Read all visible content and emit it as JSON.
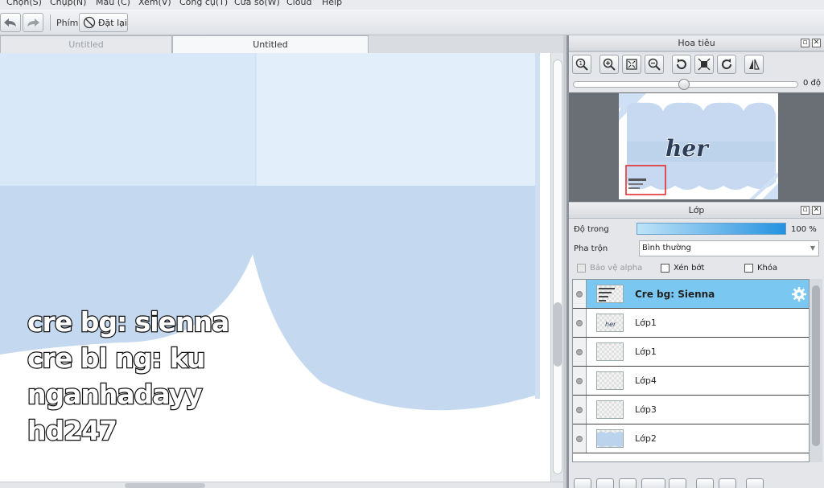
{
  "menu": [
    "Chọn(S)",
    "Chụp(N)",
    "Màu (C)",
    "Xem(V)",
    "Công cụ(T)",
    "Cửa sổ(W)",
    "Cloud",
    "Help"
  ],
  "toolbar": {
    "key_label": "Phím",
    "reset_label": "Đặt lại"
  },
  "tabs": [
    {
      "label": "Untitled",
      "active": false
    },
    {
      "label": "Untitled",
      "active": true
    }
  ],
  "canvas": {
    "credit_lines": [
      "cre bg: sienna",
      "cre bl ng: ku",
      "nganhadayy",
      "hd247"
    ],
    "colors": {
      "light_blue": "#d6e6f7",
      "mid_blue": "#bed5ee",
      "deep_blue": "#b7cfea"
    }
  },
  "navigator": {
    "title": "Hoa tiêu",
    "zoom_angle": "0 độ",
    "preview_text": "her"
  },
  "layers_panel": {
    "title": "Lớp",
    "opacity_label": "Độ trong",
    "opacity_value": "100 %",
    "blend_label": "Pha trộn",
    "blend_value": "Bình thường",
    "protect_alpha": "Bảo vệ alpha",
    "clipping": "Xén bớt",
    "lock": "Khóa",
    "layers": [
      {
        "name": "Cre bg: Sienna",
        "selected": true
      },
      {
        "name": "Lớp1",
        "selected": false
      },
      {
        "name": "Lớp1",
        "selected": false
      },
      {
        "name": "Lớp4",
        "selected": false
      },
      {
        "name": "Lớp3",
        "selected": false
      },
      {
        "name": "Lớp2",
        "selected": false
      }
    ]
  }
}
